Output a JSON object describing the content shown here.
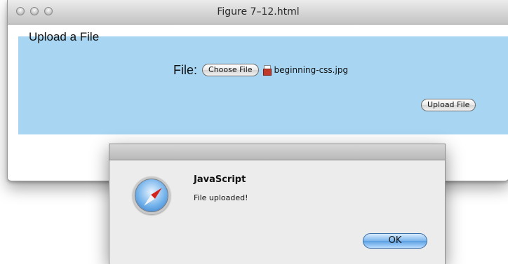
{
  "window": {
    "title": "Figure 7–12.html"
  },
  "page": {
    "heading": "Upload a File",
    "file_label": "File:",
    "choose_button": "Choose File",
    "file_name": "beginning-css.jpg",
    "upload_button": "Upload File",
    "background_color": "#a8d6f2"
  },
  "dialog": {
    "title": "JavaScript",
    "message": "File uploaded!",
    "ok_button": "OK",
    "icon": "safari-compass-icon"
  }
}
